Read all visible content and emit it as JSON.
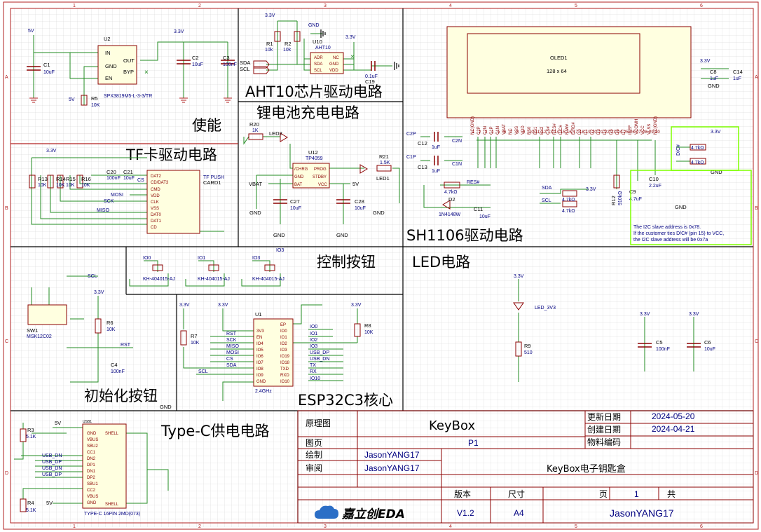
{
  "frame": {
    "columns": [
      "1",
      "2",
      "3",
      "4",
      "5",
      "6"
    ],
    "rows": [
      "A",
      "B",
      "C",
      "D"
    ]
  },
  "sections": {
    "enable": "使能",
    "aht10": "AHT10芯片驱动电路",
    "battery": "锂电池充电电路",
    "tf": "TF卡驱动电路",
    "sh1106": "SH1106驱动电路",
    "buttons": "控制按钮",
    "led": "LED电路",
    "init_button": "初始化按钮",
    "esp32": "ESP32C3核心",
    "typec": "Type-C供电电路"
  },
  "components": {
    "u2": {
      "ref": "U2",
      "value": "SPX3819M5-L-3-3/TR",
      "pins": [
        "IN",
        "GND",
        "EN",
        "OUT",
        "BYP"
      ]
    },
    "c1": {
      "ref": "C1",
      "value": "10uF"
    },
    "c2": {
      "ref": "C2",
      "value": "10uF"
    },
    "c3": {
      "ref": "C3",
      "value": "100nF"
    },
    "r5": {
      "ref": "R5",
      "value": "10K"
    },
    "r1": {
      "ref": "R1",
      "value": "10k"
    },
    "r2": {
      "ref": "R2",
      "value": "10k"
    },
    "u10": {
      "ref": "U10",
      "value": "AHT10",
      "pins": [
        "ADR",
        "SDA",
        "SCL",
        "NC",
        "GND",
        "VDD"
      ]
    },
    "c19": {
      "ref": "C19",
      "value": "0.1uF"
    },
    "r20": {
      "ref": "R20",
      "value": "1K"
    },
    "led2": {
      "ref": "LED2"
    },
    "u12": {
      "ref": "U12",
      "value": "TP4059",
      "pins": [
        "/CHRG",
        "PROG",
        "GND",
        "STDBY",
        "BAT",
        "VCC"
      ]
    },
    "r21": {
      "ref": "R21",
      "value": "1.5K"
    },
    "led1": {
      "ref": "LED1"
    },
    "c27": {
      "ref": "C27",
      "value": "10uF"
    },
    "c28": {
      "ref": "C28",
      "value": "10uF"
    },
    "card1": {
      "ref": "CARD1",
      "value": "TF PUSH",
      "pins": [
        "DAT2",
        "CD/DAT3",
        "CMD",
        "VDD",
        "CLK",
        "VSS",
        "DAT0",
        "DAT1",
        "CD"
      ]
    },
    "r13": {
      "ref": "R13",
      "value": "10K"
    },
    "r14": {
      "ref": "R14",
      "value": "10K"
    },
    "r15": {
      "ref": "R15",
      "value": "10K"
    },
    "r16": {
      "ref": "R16",
      "value": "10K"
    },
    "c20": {
      "ref": "C20",
      "value": "100nF"
    },
    "c21": {
      "ref": "C21",
      "value": "10uF"
    },
    "oled1": {
      "ref": "OLED1",
      "value": "128 x 64",
      "pins": [
        "NC(GND)",
        "C2P",
        "C2N",
        "C1P",
        "C1N",
        "VBAT",
        "NC",
        "VSS",
        "VDD",
        "BS0",
        "BS1",
        "BS2",
        "CS#",
        "RES#",
        "D/C#",
        "R/W#",
        "E/RD#",
        "D0",
        "D1",
        "D2",
        "D3",
        "D4",
        "D5",
        "D6",
        "D7",
        "IREF",
        "VCOMH",
        "VCC",
        "VLSS",
        "NC(GND)"
      ]
    },
    "c12": {
      "ref": "C12",
      "value": "1uF"
    },
    "c13": {
      "ref": "C13",
      "value": "1uF"
    },
    "c8": {
      "ref": "C8",
      "value": "1uF"
    },
    "c14": {
      "ref": "C14",
      "value": "1uF"
    },
    "r12": {
      "ref": "R12",
      "value": "910kΩ"
    },
    "c9": {
      "ref": "C9",
      "value": "4.7uF"
    },
    "c10": {
      "ref": "C10",
      "value": "2.2uF"
    },
    "d2": {
      "ref": "D2",
      "value": "1N4148W"
    },
    "c11": {
      "ref": "C11",
      "value": "10uF"
    },
    "r_res": {
      "value": "4.7kΩ"
    },
    "r_sda": {
      "value": "4.7kΩ"
    },
    "r_scl": {
      "value": "4.7kΩ"
    },
    "r_dc1": {
      "value": "4.7kΩ"
    },
    "r_dc2": {
      "value": "4.7kΩ"
    },
    "sw_io0": {
      "ref": "IO0",
      "value": "KH-404015-AJ"
    },
    "sw_io1": {
      "ref": "IO1",
      "value": "KH-404015-AJ"
    },
    "sw_io3": {
      "ref": "IO3",
      "value": "KH-404015-AJ"
    },
    "led_3v3": {
      "ref": "LED_3V3"
    },
    "r9": {
      "ref": "R9",
      "value": "510"
    },
    "c5": {
      "ref": "C5",
      "value": "100nF"
    },
    "c6": {
      "ref": "C6",
      "value": "10uF"
    },
    "sw1": {
      "ref": "SW1",
      "value": "MSK12C02"
    },
    "r6": {
      "ref": "R6",
      "value": "10K"
    },
    "c4": {
      "ref": "C4",
      "value": "100nF"
    },
    "u1": {
      "ref": "U1",
      "value": "2.4GHz",
      "left_pins": [
        "3V3",
        "EN",
        "IO4",
        "IO5",
        "IO6",
        "IO7",
        "IO8",
        "IO9",
        "GND"
      ],
      "right_pins": [
        "EP",
        "IO0",
        "IO1",
        "IO2",
        "IO3",
        "IO19",
        "IO18",
        "TXD",
        "RXD",
        "IO10"
      ]
    },
    "r7": {
      "ref": "R7",
      "value": "10K"
    },
    "r8": {
      "ref": "R8",
      "value": "10K"
    },
    "usb1": {
      "ref": "USB1",
      "value": "TYPE-C 16PIN 2MD(073)",
      "pins": [
        "GND",
        "VBUS",
        "SBU2",
        "CC1",
        "DN2",
        "DP1",
        "DN1",
        "DP2",
        "SBU1",
        "CC2",
        "VBUS",
        "GND"
      ],
      "shell": "SHELL"
    },
    "r3": {
      "ref": "R3",
      "value": "5.1K"
    },
    "r4": {
      "ref": "R4",
      "value": "5.1K"
    }
  },
  "nets": {
    "v33": "3.3V",
    "v5": "5V",
    "gnd": "GND",
    "vbat": "VBAT",
    "sda": "SDA",
    "scl": "SCL",
    "rst": "RST",
    "sck": "SCK",
    "miso": "MISO",
    "mosi": "MOSI",
    "cs": "CS",
    "usb_dp": "USB_DP",
    "usb_dn": "USB_DN",
    "tx": "TX",
    "rx": "RX",
    "io0": "IO0",
    "io1": "IO1",
    "io2": "IO2",
    "io3": "IO3",
    "io10": "IO10",
    "res": "RES#",
    "dc": "D/C#",
    "c2p": "C2P",
    "c2n": "C2N",
    "c1p": "C1P",
    "c1n": "C1N"
  },
  "note": {
    "line1": "The I2C slave address is 0x78.",
    "line2": "If the customer ties D/C# (pin 15) to VCC,",
    "line3": "the I2C slave address will be 0x7a"
  },
  "title_block": {
    "label_schematic": "原理图",
    "project": "KeyBox",
    "label_update": "更新日期",
    "update_date": "2024-05-20",
    "label_create": "创建日期",
    "create_date": "2024-04-21",
    "label_sheet": "图页",
    "sheet": "P1",
    "label_material": "物料编码",
    "label_drawn": "绘制",
    "drawn_by": "JasonYANG17",
    "label_review": "审阅",
    "reviewed_by": "JasonYANG17",
    "description": "KeyBox电子钥匙盒",
    "label_version": "版本",
    "version": "V1.2",
    "label_size": "尺寸",
    "size": "A4",
    "label_page": "页",
    "page": "1",
    "label_total": "共",
    "author": "JasonYANG17",
    "logo_text": "嘉立创EDA"
  },
  "colors": {
    "frame": "#b22222",
    "wire": "#228b22",
    "component": "#8b0000",
    "netlabel": "#000080",
    "note_box": "#7fff00"
  }
}
